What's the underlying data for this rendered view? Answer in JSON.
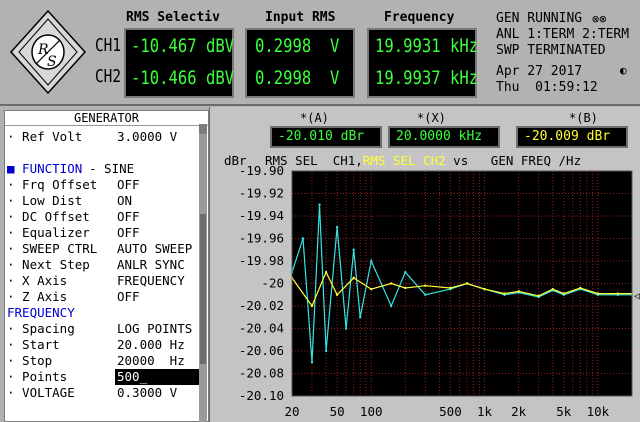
{
  "header": {
    "col_rms_selectiv": "RMS Selectiv",
    "col_input_rms": "Input RMS",
    "col_frequency": "Frequency"
  },
  "channels": [
    {
      "label": "CH1",
      "rms_selectiv": "-10.467 dBV",
      "input_rms": "0.2998  V",
      "frequency": "19.9931 kHz"
    },
    {
      "label": "CH2",
      "rms_selectiv": "-10.466 dBV",
      "input_rms": "0.2998  V",
      "frequency": "19.9937 kHz"
    }
  ],
  "status": {
    "gen": "GEN RUNNING",
    "anl": "ANL 1:TERM 2:TERM",
    "swp": "SWP TERMINATED",
    "date": "Apr 27 2017",
    "time": "Thu  01:59:12"
  },
  "generator": {
    "title": "GENERATOR",
    "rows": [
      {
        "label": "· Ref Volt",
        "value": "3.0000 V"
      },
      {
        "label": "■ FUNCTION",
        "value": "- SINE"
      },
      {
        "label": "· Frq Offset",
        "value": "OFF"
      },
      {
        "label": "· Low Dist",
        "value": "ON"
      },
      {
        "label": "· DC Offset",
        "value": "OFF"
      },
      {
        "label": "· Equalizer",
        "value": "OFF"
      },
      {
        "label": "· SWEEP CTRL",
        "value": "AUTO SWEEP"
      },
      {
        "label": "· Next Step",
        "value": "ANLR SYNC"
      },
      {
        "label": "· X Axis",
        "value": "FREQUENCY"
      },
      {
        "label": "· Z Axis",
        "value": "OFF"
      },
      {
        "label": "FREQUENCY",
        "value": ""
      },
      {
        "label": "· Spacing",
        "value": "LOG POINTS"
      },
      {
        "label": "· Start",
        "value": "20.000 Hz"
      },
      {
        "label": "· Stop",
        "value": "20000  Hz"
      },
      {
        "label": "· Points",
        "value": "500_"
      },
      {
        "label": "· VOLTAGE",
        "value": "0.3000 V"
      }
    ]
  },
  "cursors": {
    "a_label": "*(A)",
    "a_value": "-20.010 dBr",
    "x_label": "*(X)",
    "x_value": "20.0000 kHz",
    "b_label": "*(B)",
    "b_value": "-20.009 dBr"
  },
  "plot_header": {
    "unit": "dBr",
    "text1": "RMS SEL  CH1,",
    "text2": "RMS SEL",
    "text3": "CH2",
    "text4": " vs   GEN FREQ /Hz"
  },
  "colors": {
    "ch1": "#33e6e6",
    "ch2": "#ffff33",
    "display_green": "#3cff3c",
    "plot_bg": "#000000",
    "grid": "#9a1e1e"
  },
  "chart_data": {
    "type": "line",
    "x_scale": "log",
    "xlim": [
      20,
      20000
    ],
    "ylim": [
      -20.1,
      -19.9
    ],
    "yticks": [
      "-19.90",
      "-19.92",
      "-19.94",
      "-19.96",
      "-19.98",
      "-20",
      "-20.02",
      "-20.04",
      "-20.06",
      "-20.08",
      "-20.10"
    ],
    "xticks": [
      "20",
      "50",
      "100",
      "500",
      "1k",
      "2k",
      "5k",
      "10k"
    ],
    "xtick_values": [
      20,
      50,
      100,
      500,
      1000,
      2000,
      5000,
      10000
    ],
    "series": [
      {
        "name": "CH1",
        "color": "#33e6e6",
        "x": [
          20,
          25,
          30,
          35,
          40,
          50,
          60,
          70,
          80,
          100,
          150,
          200,
          300,
          500,
          700,
          1000,
          1500,
          2000,
          3000,
          4000,
          5000,
          7000,
          10000,
          15000,
          20000
        ],
        "y": [
          -19.99,
          -19.96,
          -20.07,
          -19.93,
          -20.06,
          -19.95,
          -20.04,
          -19.97,
          -20.03,
          -19.98,
          -20.02,
          -19.99,
          -20.01,
          -20.005,
          -20.0,
          -20.005,
          -20.01,
          -20.008,
          -20.012,
          -20.006,
          -20.01,
          -20.005,
          -20.01,
          -20.01,
          -20.01
        ]
      },
      {
        "name": "CH2",
        "color": "#ffff33",
        "x": [
          20,
          30,
          40,
          50,
          70,
          100,
          150,
          200,
          300,
          500,
          700,
          1000,
          1500,
          2000,
          3000,
          4000,
          5000,
          7000,
          10000,
          15000,
          20000
        ],
        "y": [
          -19.995,
          -20.02,
          -19.99,
          -20.01,
          -19.995,
          -20.005,
          -20.0,
          -20.004,
          -20.002,
          -20.004,
          -20.0,
          -20.005,
          -20.009,
          -20.007,
          -20.011,
          -20.005,
          -20.009,
          -20.004,
          -20.009,
          -20.009,
          -20.009
        ]
      }
    ]
  }
}
